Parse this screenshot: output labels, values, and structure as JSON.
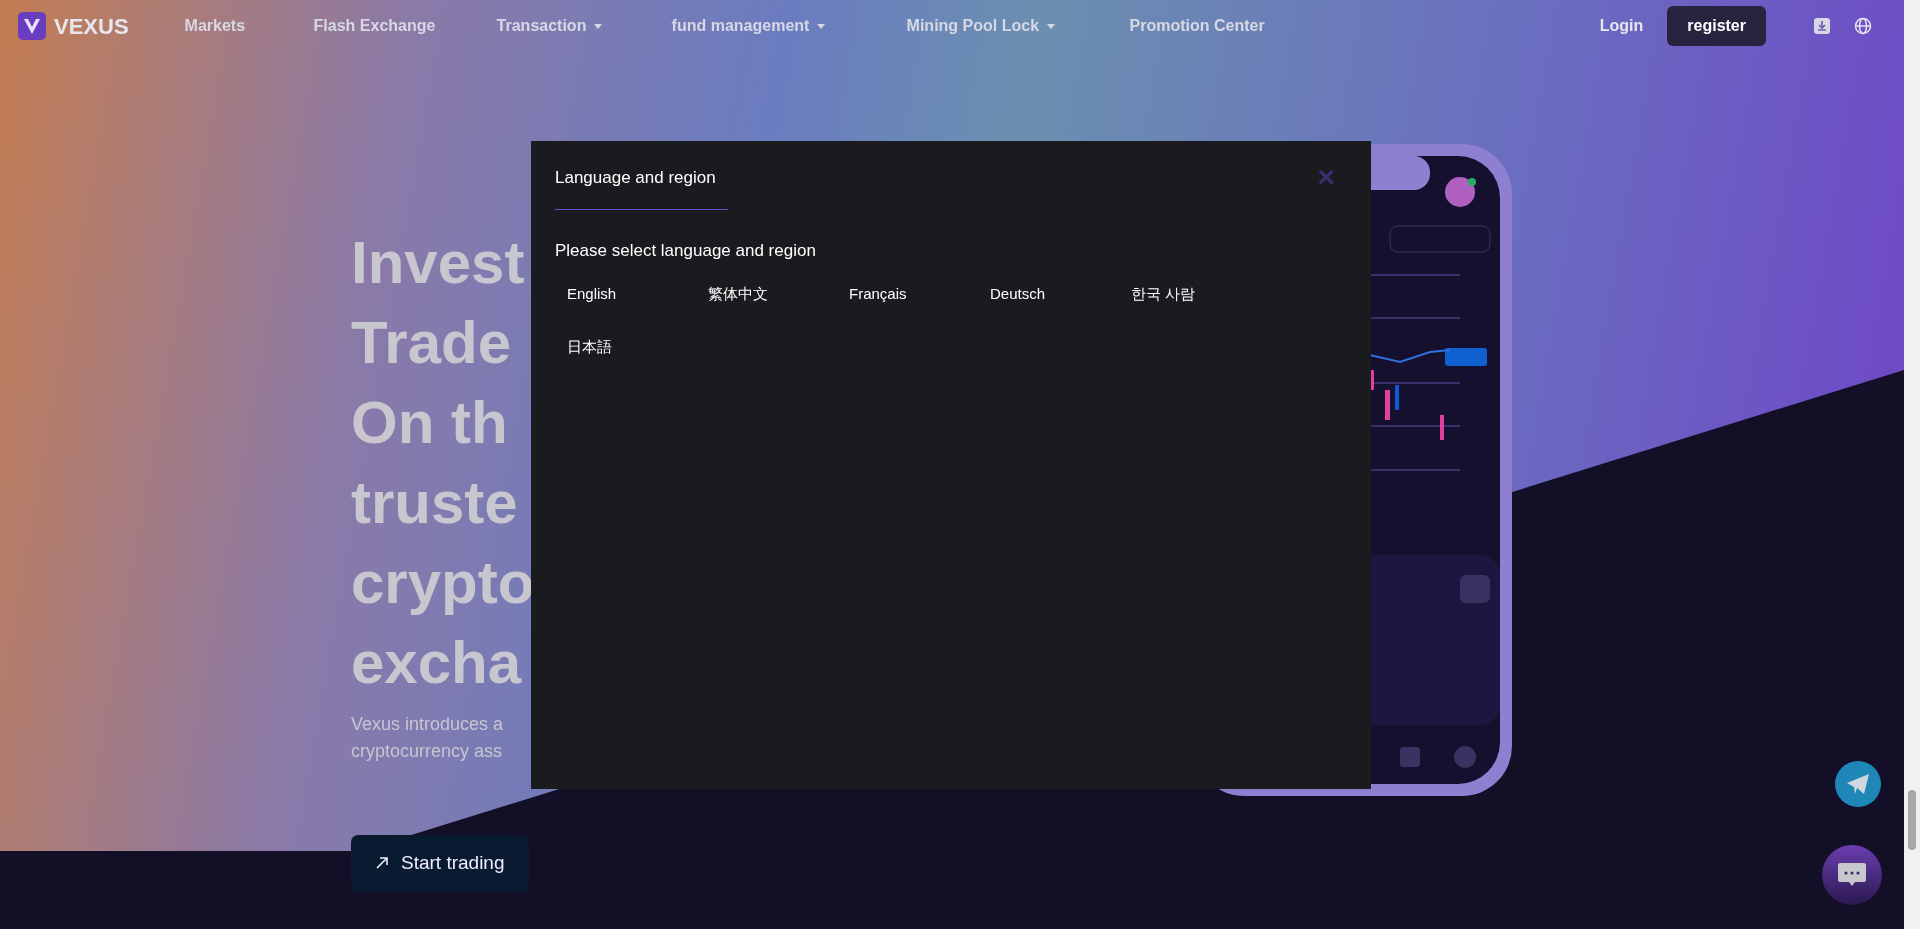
{
  "nav": {
    "brand": "VEXUS",
    "items": [
      {
        "label": "Markets",
        "dropdown": false
      },
      {
        "label": "Flash Exchange",
        "dropdown": false
      },
      {
        "label": "Transaction",
        "dropdown": true
      },
      {
        "label": "fund management",
        "dropdown": true
      },
      {
        "label": "Mining Pool Lock",
        "dropdown": true
      },
      {
        "label": "Promotion Center",
        "dropdown": false
      }
    ],
    "login": "Login",
    "register": "register"
  },
  "hero": {
    "title_lines": [
      "Invest",
      "Trade",
      "On th",
      "truste",
      "crypto",
      "excha"
    ],
    "subtitle_lines": [
      "Vexus introduces a",
      "cryptocurrency ass"
    ],
    "cta": "Start trading"
  },
  "modal": {
    "title": "Language and region",
    "close": "×",
    "prompt": "Please select language and region",
    "languages": [
      {
        "label": "English"
      },
      {
        "label": "繁体中文"
      },
      {
        "label": "Français"
      },
      {
        "label": "Deutsch"
      },
      {
        "label": "한국 사람"
      },
      {
        "label": "日本語"
      }
    ]
  }
}
